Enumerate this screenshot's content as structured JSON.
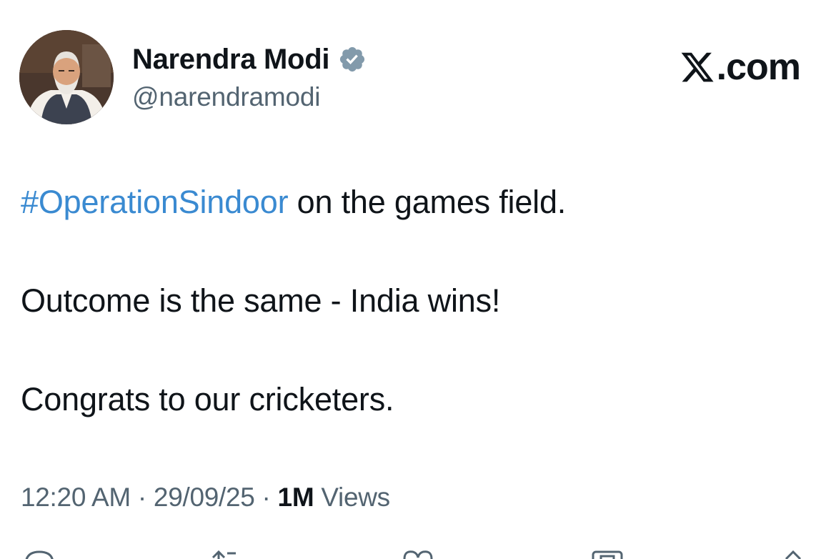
{
  "author": {
    "display_name": "Narendra Modi",
    "handle": "@narendramodi",
    "verified": true,
    "verified_color": "#829aab"
  },
  "brand": {
    "text": ".com",
    "logo_icon": "x-logo-icon"
  },
  "tweet": {
    "hashtag": "#OperationSindoor",
    "hashtag_color": "#3a8ad1",
    "line1_rest": " on the games field.",
    "line2": "Outcome is the same - India wins!",
    "line3": "Congrats to our cricketers."
  },
  "meta": {
    "time": "12:20 AM",
    "separator": " · ",
    "date": "29/09/25",
    "views_count": "1M",
    "views_label": " Views"
  },
  "actions": [
    {
      "icon": "reply-icon"
    },
    {
      "icon": "retweet-icon"
    },
    {
      "icon": "like-icon"
    },
    {
      "icon": "bookmark-icon"
    },
    {
      "icon": "share-icon"
    }
  ]
}
